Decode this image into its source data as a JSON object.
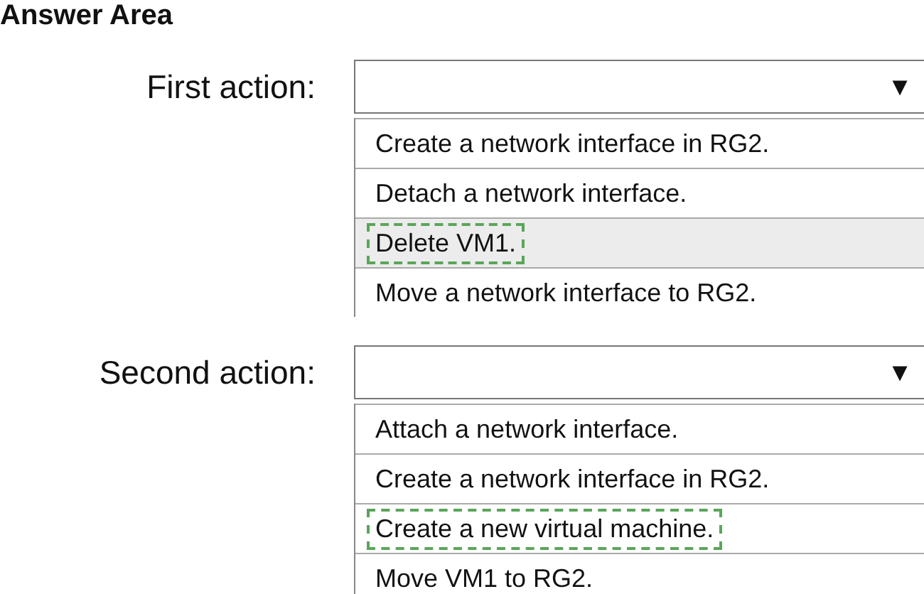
{
  "heading": "Answer Area",
  "questions": [
    {
      "label": "First action:",
      "arrow": "▼",
      "options": [
        {
          "text": "Create a network interface in RG2.",
          "selected": false,
          "highlighted": false
        },
        {
          "text": "Detach a network interface.",
          "selected": false,
          "highlighted": false
        },
        {
          "text": "Delete VM1.",
          "selected": true,
          "highlighted": true
        },
        {
          "text": "Move a network interface to RG2.",
          "selected": false,
          "highlighted": false
        }
      ]
    },
    {
      "label": "Second action:",
      "arrow": "▼",
      "options": [
        {
          "text": "Attach a network interface.",
          "selected": false,
          "highlighted": false
        },
        {
          "text": "Create a network interface in RG2.",
          "selected": false,
          "highlighted": false
        },
        {
          "text": "Create a new virtual machine.",
          "selected": true,
          "highlighted": false
        },
        {
          "text": "Move VM1 to RG2.",
          "selected": false,
          "highlighted": false
        }
      ]
    }
  ]
}
